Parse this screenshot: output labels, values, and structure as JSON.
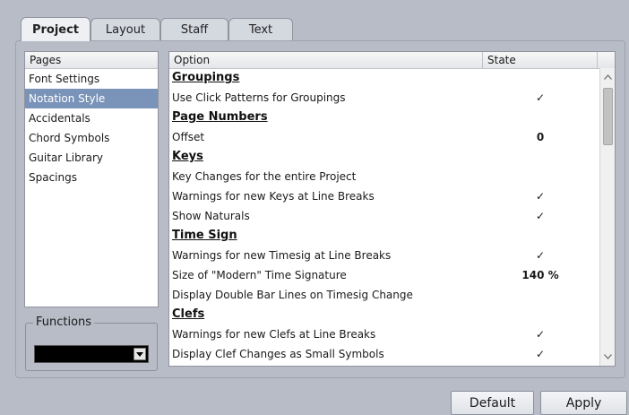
{
  "tabs": [
    {
      "label": "Project",
      "active": true
    },
    {
      "label": "Layout",
      "active": false
    },
    {
      "label": "Staff",
      "active": false
    },
    {
      "label": "Text",
      "active": false
    }
  ],
  "pages": {
    "header": "Pages",
    "items": [
      "Font Settings",
      "Notation Style",
      "Accidentals",
      "Chord Symbols",
      "Guitar Library",
      "Spacings"
    ],
    "selected": "Notation Style"
  },
  "functions": {
    "label": "Functions",
    "value": ""
  },
  "table": {
    "header_option": "Option",
    "header_state": "State",
    "rows": [
      {
        "type": "section",
        "option": "Groupings",
        "state": ""
      },
      {
        "type": "item",
        "option": "Use Click Patterns for Groupings",
        "state": "✓"
      },
      {
        "type": "section",
        "option": "Page Numbers",
        "state": ""
      },
      {
        "type": "item",
        "option": "Offset",
        "state": "0"
      },
      {
        "type": "section",
        "option": "Keys",
        "state": ""
      },
      {
        "type": "item",
        "option": "Key Changes for the entire Project",
        "state": ""
      },
      {
        "type": "item",
        "option": "Warnings for new Keys at Line Breaks",
        "state": "✓"
      },
      {
        "type": "item",
        "option": "Show Naturals",
        "state": "✓"
      },
      {
        "type": "section",
        "option": "Time Sign",
        "state": ""
      },
      {
        "type": "item",
        "option": "Warnings for new Timesig at Line Breaks",
        "state": "✓"
      },
      {
        "type": "item",
        "option": "Size of \"Modern\" Time Signature",
        "state": "140 %"
      },
      {
        "type": "item",
        "option": "Display Double Bar Lines on Timesig Change",
        "state": ""
      },
      {
        "type": "section",
        "option": "Clefs",
        "state": ""
      },
      {
        "type": "item",
        "option": "Warnings for new Clefs at Line Breaks",
        "state": "✓"
      },
      {
        "type": "item",
        "option": "Display Clef Changes as Small Symbols",
        "state": "✓"
      }
    ]
  },
  "buttons": {
    "default": "Default",
    "apply": "Apply"
  },
  "colors": {
    "background": "#b7bcc7",
    "selection": "#7a93b8"
  }
}
